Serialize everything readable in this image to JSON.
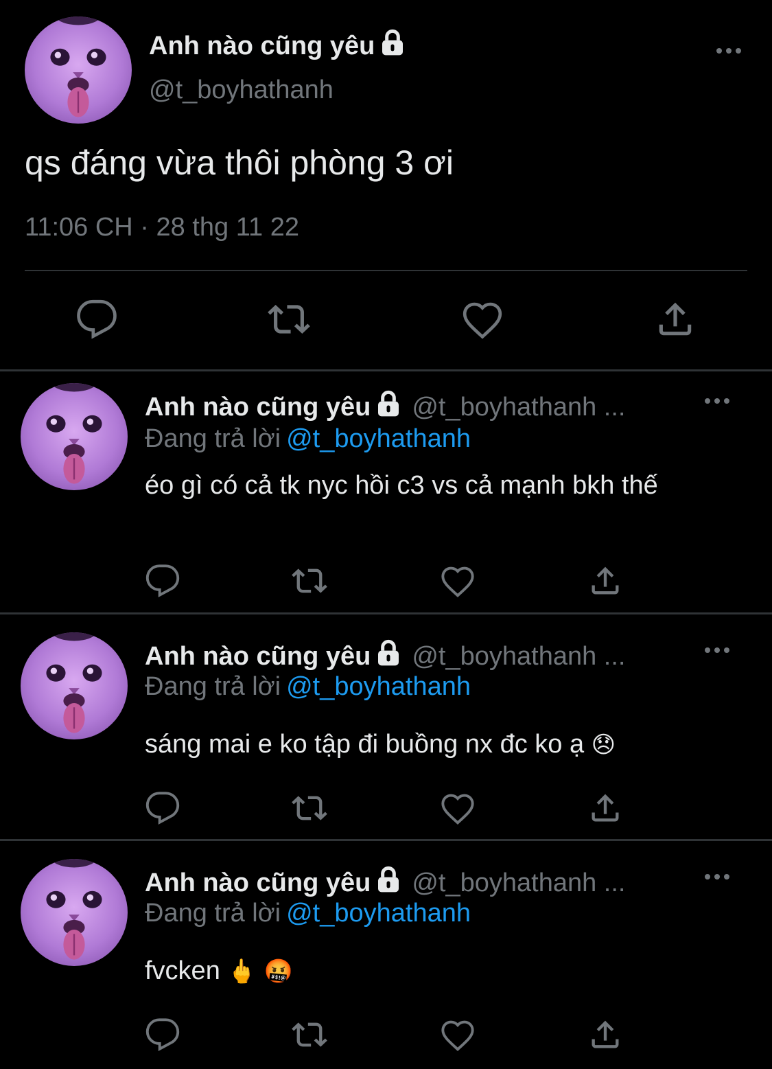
{
  "main": {
    "name": "Anh nào cũng yêu",
    "handle": "@t_boyhathanh",
    "text": "qs đáng vừa thôi phòng 3 ơi",
    "timestamp": "11:06 CH · 28 thg 11 22"
  },
  "replies": [
    {
      "name": "Anh nào cũng yêu",
      "handle": "@t_boyhathanh ...",
      "replying_label": "Đang trả lời",
      "mention": "@t_boyhathanh",
      "text": "éo gì có cả tk nyc hồi c3 vs cả mạnh bkh thế"
    },
    {
      "name": "Anh nào cũng yêu",
      "handle": "@t_boyhathanh ...",
      "replying_label": "Đang trả lời",
      "mention": "@t_boyhathanh",
      "text": "sáng mai e ko tập đi buồng nx đc ko ạ",
      "emoji": "😞"
    },
    {
      "name": "Anh nào cũng yêu",
      "handle": "@t_boyhathanh ...",
      "replying_label": "Đang trả lời",
      "mention": "@t_boyhathanh",
      "text": "fvcken",
      "emoji": "🖕 🤬"
    }
  ],
  "colors": {
    "background": "#000000",
    "text": "#e7e9ea",
    "secondary": "#71767b",
    "link": "#1d9bf0",
    "divider": "#2f3336",
    "avatar": "#b07ad6"
  },
  "icons": [
    "lock-icon",
    "more-icon",
    "reply-icon",
    "retweet-icon",
    "like-icon",
    "share-icon"
  ]
}
